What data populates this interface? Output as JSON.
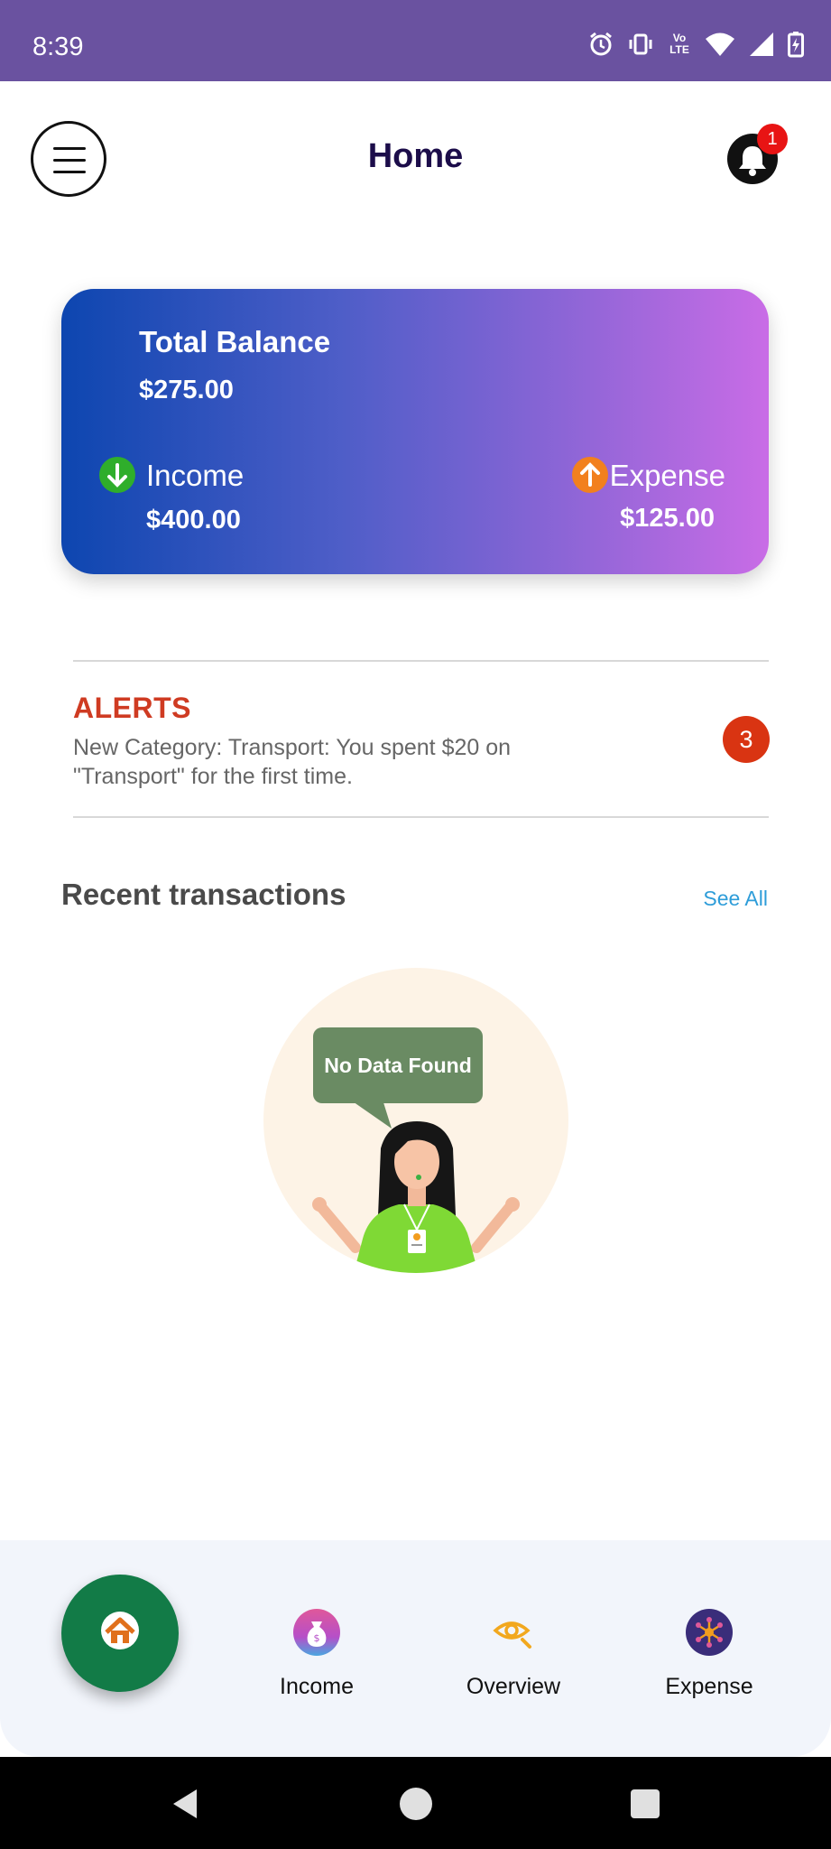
{
  "status_bar": {
    "time": "8:39",
    "network_label": "Vo LTE"
  },
  "header": {
    "title": "Home",
    "notification_count": "1"
  },
  "balance_card": {
    "total_label": "Total Balance",
    "total_value": "$275.00",
    "income_label": "Income",
    "income_value": "$400.00",
    "expense_label": "Expense",
    "expense_value": "$125.00"
  },
  "alerts": {
    "title": "ALERTS",
    "message": "New Category: Transport: You spent $20 on \"Transport\" for the first time.",
    "count": "3"
  },
  "recent": {
    "title": "Recent transactions",
    "see_all": "See All",
    "empty_text": "No Data Found"
  },
  "bottom_nav": {
    "items": [
      {
        "label": "Income"
      },
      {
        "label": "Overview"
      },
      {
        "label": "Expense"
      }
    ]
  },
  "icons": [
    "menu-icon",
    "bell-icon",
    "arrow-down-icon",
    "arrow-up-icon",
    "home-icon",
    "money-bag-icon",
    "eye-search-icon",
    "expense-network-icon",
    "alarm-icon",
    "vibrate-icon",
    "wifi-icon",
    "signal-icon",
    "battery-icon"
  ],
  "colors": {
    "status_bar": "#6a52a0",
    "card_gradient_start": "#0d46b0",
    "card_gradient_end": "#c96ce6",
    "income_accent": "#2fae2b",
    "expense_accent": "#f2801e",
    "alert_title": "#cf3b22",
    "see_all": "#2e9dd9",
    "home_fab": "#127b47"
  }
}
